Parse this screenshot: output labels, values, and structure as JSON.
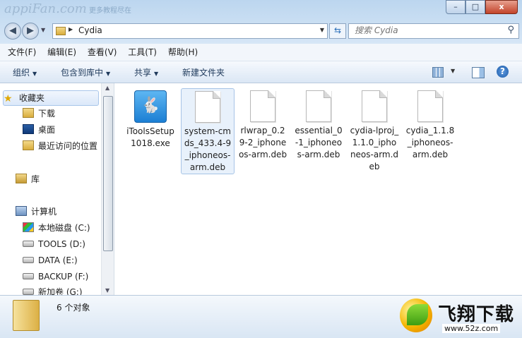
{
  "watermark": {
    "site": "appiFan.com",
    "tagline": "更多教程尽在"
  },
  "window": {
    "min": "–",
    "max": "□",
    "close": "x"
  },
  "address": {
    "path": "Cydia"
  },
  "search": {
    "placeholder": "搜索 Cydia"
  },
  "menu": [
    "文件(F)",
    "编辑(E)",
    "查看(V)",
    "工具(T)",
    "帮助(H)"
  ],
  "toolbar": {
    "organize": "组织",
    "include": "包含到库中",
    "share": "共享",
    "new_folder": "新建文件夹"
  },
  "nav": {
    "favorites": "收藏夹",
    "downloads": "下载",
    "desktop": "桌面",
    "recent": "最近访问的位置",
    "libraries": "库",
    "computer": "计算机",
    "drives": [
      "本地磁盘 (C:)",
      "TOOLS (D:)",
      "DATA (E:)",
      "BACKUP (F:)",
      "新加卷 (G:)"
    ]
  },
  "files": [
    {
      "name": "iToolsSetup1018.exe",
      "type": "exe"
    },
    {
      "name": "system-cmds_433.4-9_iphoneos-arm.deb",
      "type": "deb",
      "selected": true
    },
    {
      "name": "rlwrap_0.29-2_iphoneos-arm.deb",
      "type": "deb"
    },
    {
      "name": "essential_0-1_iphoneos-arm.deb",
      "type": "deb"
    },
    {
      "name": "cydia-lproj_1.1.0_iphoneos-arm.deb",
      "type": "deb"
    },
    {
      "name": "cydia_1.1.8_iphoneos-arm.deb",
      "type": "deb"
    }
  ],
  "status": {
    "count": "6 个对象"
  },
  "brand": {
    "name": "飞翔下载",
    "url": "www.52z.com"
  }
}
